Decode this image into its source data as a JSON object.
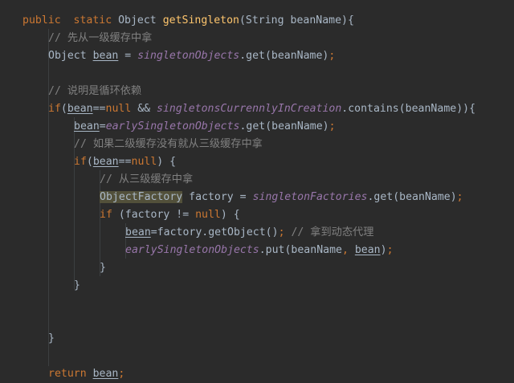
{
  "code": {
    "l1": {
      "kw_public": "public",
      "sp1": "  ",
      "kw_static": "static",
      "t_object": " Object ",
      "fn_name": "getSingleton",
      "params": "(String beanName){"
    },
    "l2": {
      "comment": "// 先从一级缓存中拿"
    },
    "l3": {
      "t_type": "Object ",
      "var": "bean",
      "eq": " = ",
      "field": "singletonObjects",
      "call": ".get(beanName)",
      "semi": ";"
    },
    "l5": {
      "comment": "// 说明是循环依赖"
    },
    "l6": {
      "kw_if": "if",
      "open": "(",
      "var": "bean",
      "eqeq": "==",
      "kw_null": "null",
      "and": " && ",
      "field": "singletonsCurrennlyInCreation",
      "call": ".contains(beanName)){"
    },
    "l7": {
      "var": "bean",
      "eq": "=",
      "field": "earlySingletonObjects",
      "call": ".get(beanName)",
      "semi": ";"
    },
    "l8": {
      "comment": "// 如果二级缓存没有就从三级缓存中拿"
    },
    "l9": {
      "kw_if": "if",
      "open": "(",
      "var": "bean",
      "eqeq": "==",
      "kw_null": "null",
      "close": ") {"
    },
    "l10": {
      "comment": "// 从三级缓存中拿"
    },
    "l11": {
      "type": "ObjectFactory",
      "t_factory": " factory = ",
      "field": "singletonFactories",
      "call": ".get(beanName)",
      "semi": ";"
    },
    "l12": {
      "kw_if": "if",
      "t_cond": " (factory != ",
      "kw_null": "null",
      "close": ") {"
    },
    "l13": {
      "var": "bean",
      "t_call": "=factory.getObject()",
      "semi": ";",
      "sp": " ",
      "comment": "// 拿到动态代理"
    },
    "l14": {
      "field": "earlySingletonObjects",
      "t_put": ".put(beanName",
      "comma": ",",
      "sp": " ",
      "var": "bean",
      "close": ")",
      "semi": ";"
    },
    "l15": {
      "brace": "}"
    },
    "l16": {
      "brace": "}"
    },
    "l19": {
      "brace": "}"
    },
    "l21": {
      "kw_return": "return",
      "sp": " ",
      "var": "bean",
      "semi": ";"
    }
  },
  "colors": {
    "background": "#2b2b2b",
    "text": "#a9b7c6",
    "keyword": "#cc7832",
    "method": "#ffc66d",
    "comment": "#808080",
    "field": "#9876aa",
    "highlight": "#52503a"
  }
}
